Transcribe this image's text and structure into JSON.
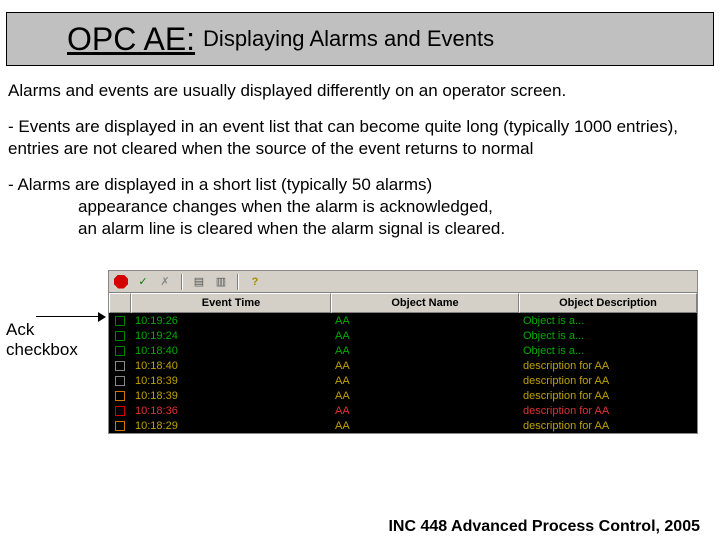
{
  "title": {
    "main": "OPC AE:",
    "sub": "Displaying Alarms and Events"
  },
  "p1": "Alarms and events are usually displayed differently on an operator screen.",
  "p2": "- Events are displayed in an event list that can become quite long (typically 1000 entries), entries are not cleared when the source of the event returns to normal",
  "p3": "- Alarms are displayed in a short list (typically 50 alarms)",
  "p3a": "appearance changes when the alarm is acknowledged,",
  "p3b": "an alarm line is cleared when the alarm signal is cleared.",
  "ack_label1": "Ack",
  "ack_label2": "checkbox",
  "headers": {
    "time": "Event Time",
    "obj": "Object Name",
    "desc": "Object Description"
  },
  "toolbar_icons": {
    "stop": "STOP",
    "check": "✓",
    "checkx": "✗",
    "doc": "▤",
    "book": "▥",
    "help": "?"
  },
  "rows": [
    {
      "time": "10:19:26",
      "obj": "AA",
      "desc": "Object is a...",
      "box": "#008000",
      "color": "#00aa00"
    },
    {
      "time": "10:19:24",
      "obj": "AA",
      "desc": "Object is a...",
      "box": "#008000",
      "color": "#00aa00"
    },
    {
      "time": "10:18:40",
      "obj": "AA",
      "desc": "Object is a...",
      "box": "#008000",
      "color": "#00aa00"
    },
    {
      "time": "10:18:40",
      "obj": "AA",
      "desc": "description for AA",
      "box": "#888888",
      "color": "#c0a000"
    },
    {
      "time": "10:18:39",
      "obj": "AA",
      "desc": "description for AA",
      "box": "#888888",
      "color": "#c0a000"
    },
    {
      "time": "10:18:39",
      "obj": "AA",
      "desc": "description for AA",
      "box": "#cc7700",
      "color": "#c0a000"
    },
    {
      "time": "10:18:36",
      "obj": "AA",
      "desc": "description for AA",
      "box": "#d40000",
      "color": "#dd3333"
    },
    {
      "time": "10:18:29",
      "obj": "AA",
      "desc": "description for AA",
      "box": "#cc7700",
      "color": "#c0a000"
    }
  ],
  "footer": "INC 448 Advanced Process Control, 2005"
}
